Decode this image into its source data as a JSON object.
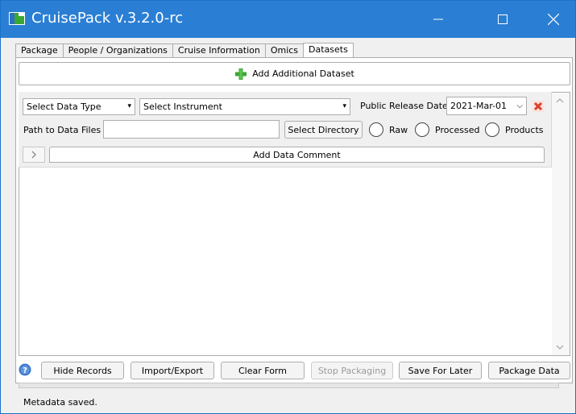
{
  "window": {
    "title": "CruisePack v.3.2.0-rc"
  },
  "tabs": [
    {
      "label": "Package"
    },
    {
      "label": "People / Organizations"
    },
    {
      "label": "Cruise Information"
    },
    {
      "label": "Omics"
    },
    {
      "label": "Datasets"
    }
  ],
  "active_tab": "Datasets",
  "datasets": {
    "add_button_label": "Add Additional Dataset",
    "data_type_select": "Select Data Type",
    "instrument_select": "Select Instrument",
    "public_release_label": "Public Release Date",
    "public_release_value": "2021-Mar-01",
    "path_label": "Path to Data Files",
    "path_value": "",
    "select_directory_label": "Select Directory",
    "radio_raw": "Raw",
    "radio_processed": "Processed",
    "radio_products": "Products",
    "add_comment_label": "Add Data Comment"
  },
  "bottom_buttons": {
    "hide_records": "Hide Records",
    "import_export": "Import/Export",
    "clear_form": "Clear Form",
    "stop_packaging": "Stop Packaging",
    "save_for_later": "Save For Later",
    "package_data": "Package Data"
  },
  "status": {
    "text": "Metadata saved.",
    "progress": 0
  },
  "icons": {
    "app": "cruisepack-app-icon",
    "add": "plus-icon",
    "delete": "delete-x-icon",
    "help": "help-icon",
    "expand": "chevron-right-icon"
  },
  "colors": {
    "titlebar": "#2a7fd4",
    "add_icon": "#3aa832",
    "delete_icon": "#d9412b",
    "help_icon": "#3b78c9"
  }
}
